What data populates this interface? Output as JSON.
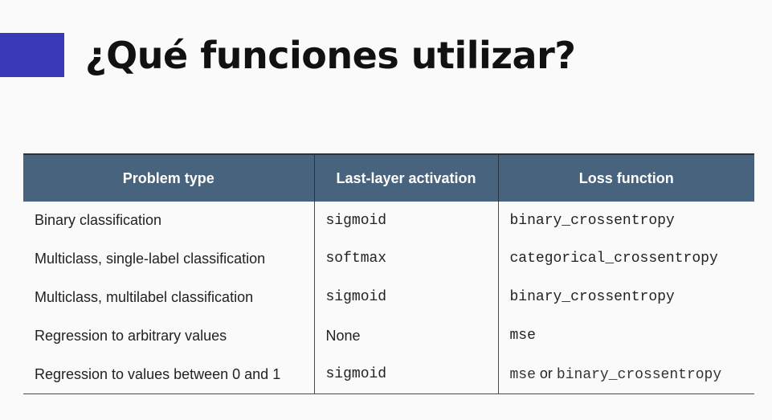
{
  "slide": {
    "title": "¿Qué funciones utilizar?",
    "accent_color": "#3a3ab8"
  },
  "table": {
    "header_color": "#48637e",
    "headers": [
      "Problem type",
      "Last-layer activation",
      "Loss function"
    ],
    "rows": [
      {
        "problem": "Binary classification",
        "activation": "sigmoid",
        "loss": "binary_crossentropy"
      },
      {
        "problem": "Multiclass, single-label classification",
        "activation": "softmax",
        "loss": "categorical_crossentropy"
      },
      {
        "problem": "Multiclass, multilabel classification",
        "activation": "sigmoid",
        "loss": "binary_crossentropy"
      },
      {
        "problem": "Regression to arbitrary values",
        "activation": "None",
        "loss": "mse"
      },
      {
        "problem": "Regression to values between 0 and 1",
        "activation": "sigmoid",
        "loss_part1": "mse",
        "loss_joiner": " or ",
        "loss_part2": "binary_crossentropy"
      }
    ]
  }
}
